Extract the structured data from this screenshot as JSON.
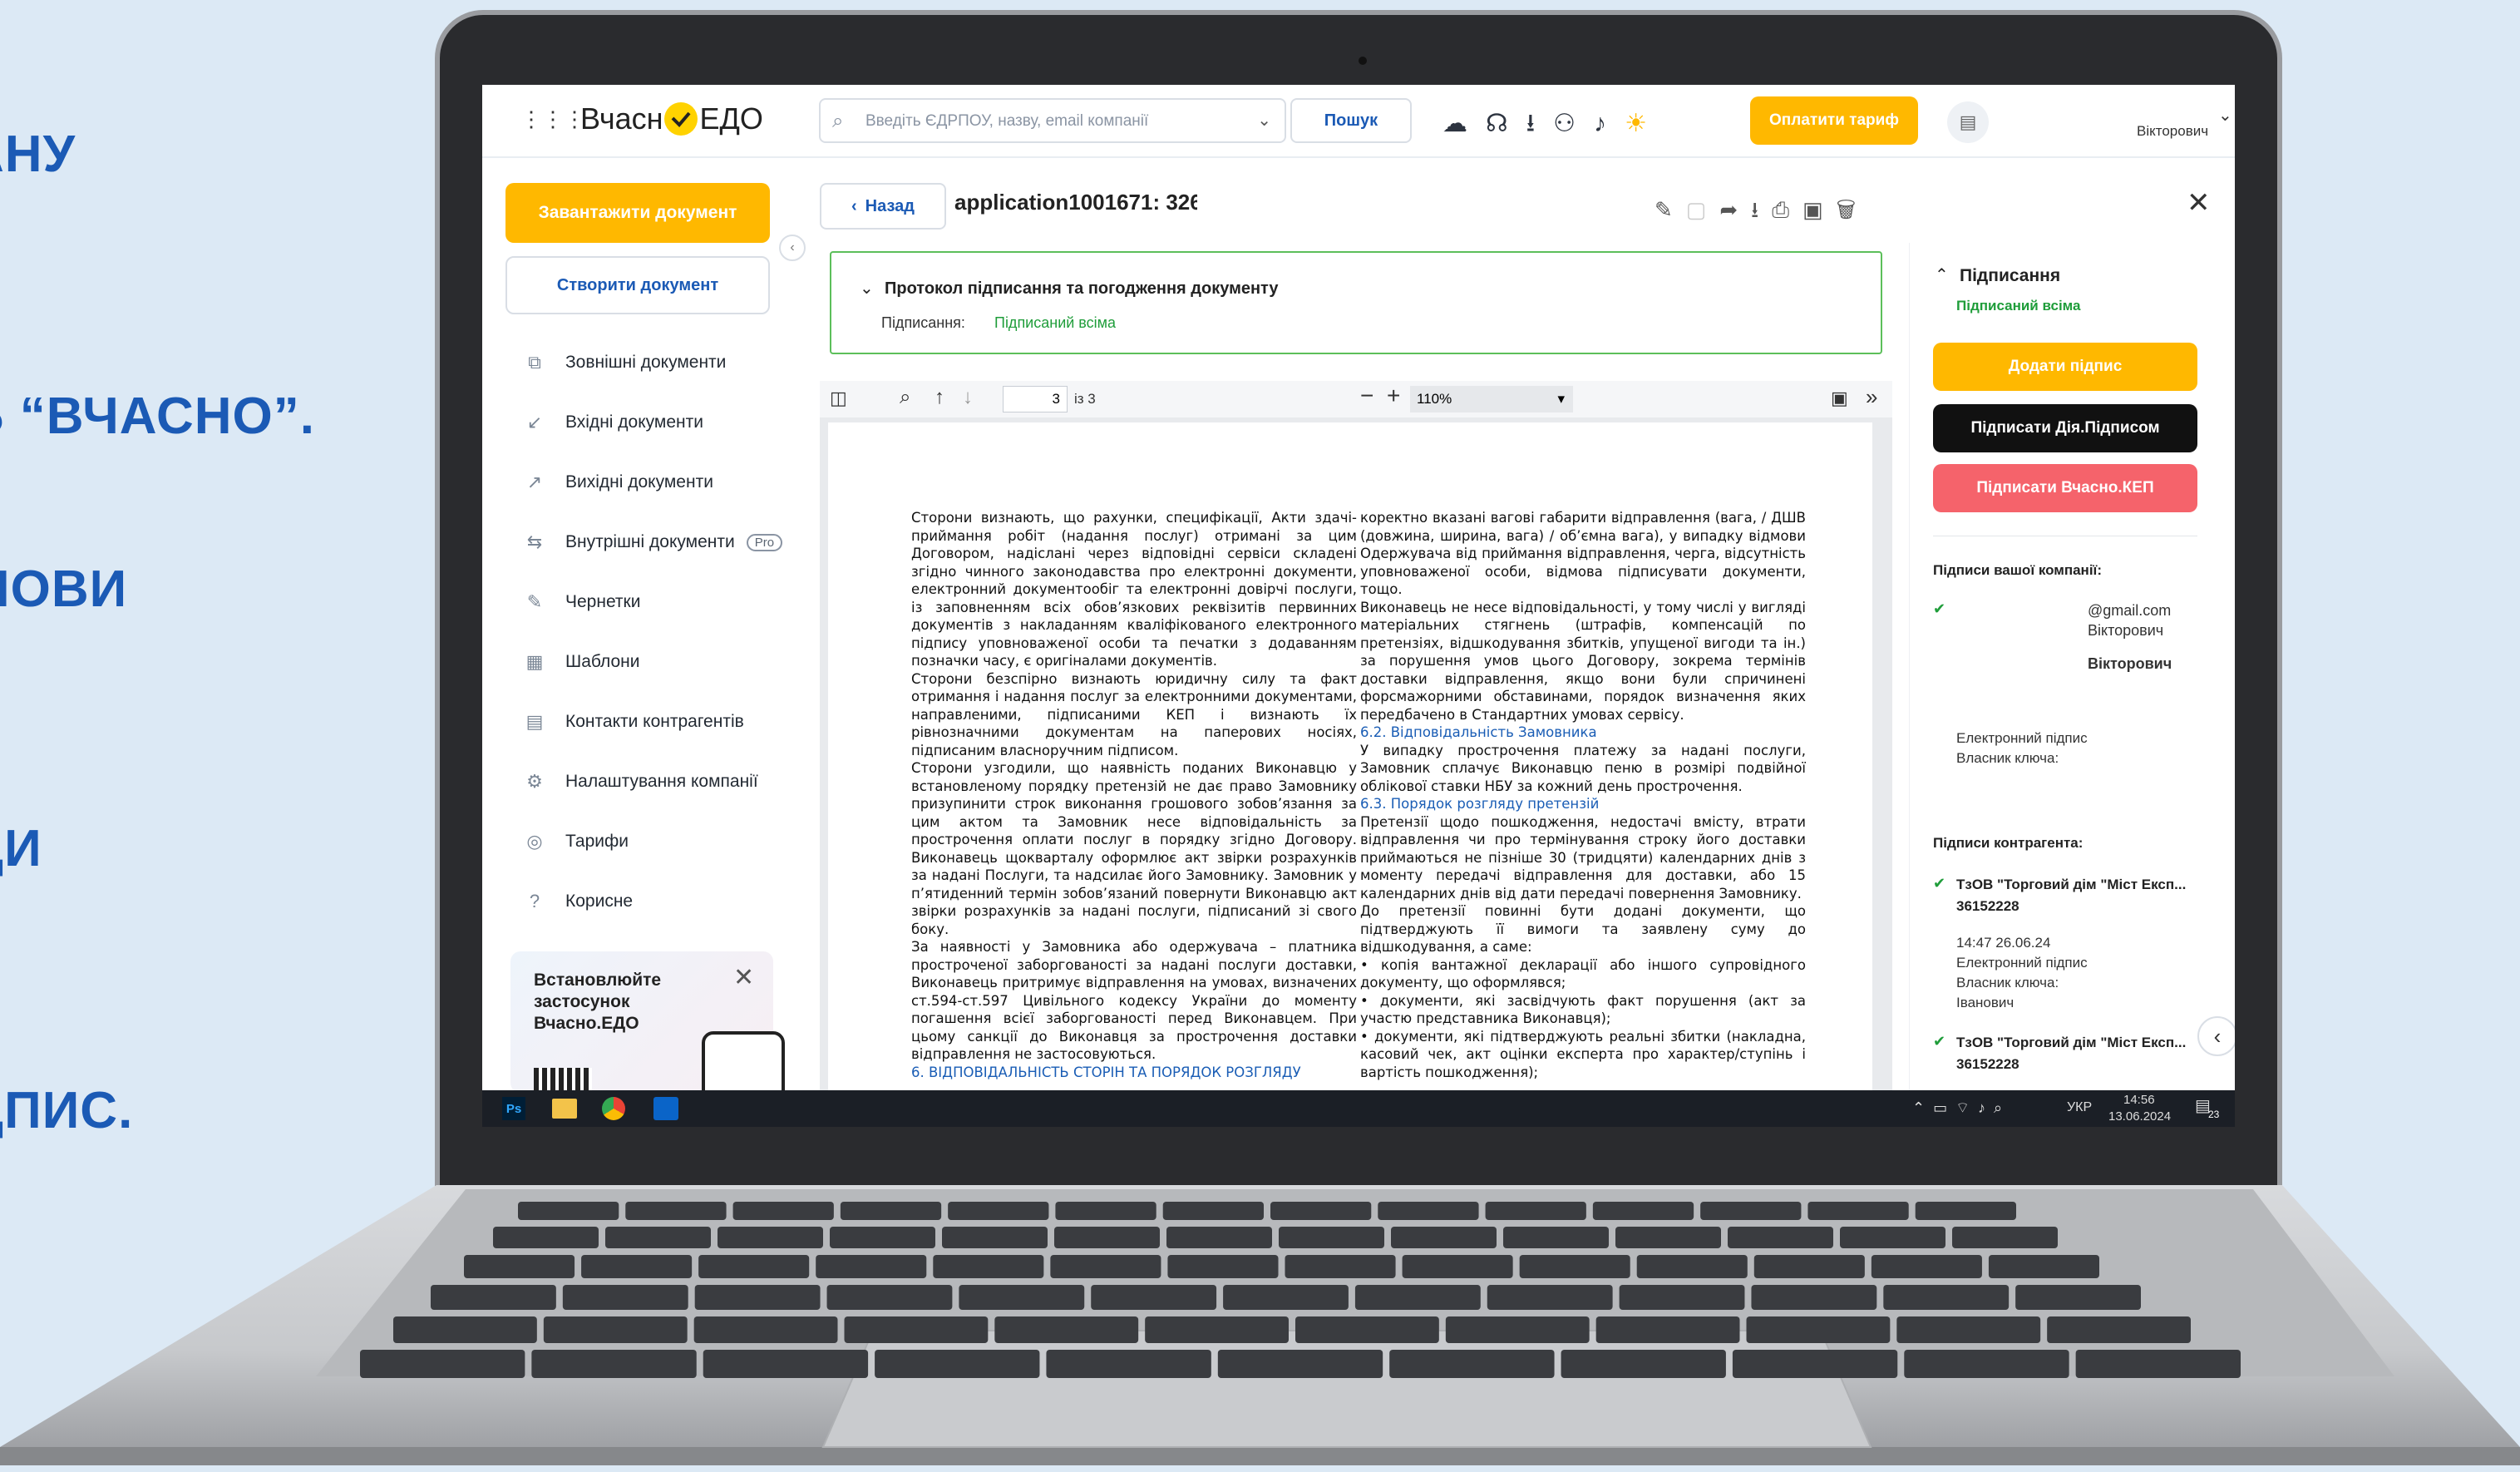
{
  "promo": {
    "line1": "АНУ",
    "line2": "Ь “ВЧАСНО”.",
    "line3": "МОВИ",
    "line4": "ДИ",
    "line5": "ДПИС."
  },
  "app": {
    "logo_text_left": "Вчасн",
    "logo_text_right": "ЕДО",
    "search_placeholder": "Введіть ЄДРПОУ, назву, email компанії",
    "search_button": "Пошук",
    "pay_button": "Оплатити тариф",
    "user_name": "Вікторович"
  },
  "sidebar": {
    "upload_button": "Завантажити документ",
    "create_button": "Створити документ",
    "items": [
      {
        "label": "Зовнішні документи",
        "icon": "external-docs-icon"
      },
      {
        "label": "Вхідні документи",
        "icon": "incoming-arrow-icon"
      },
      {
        "label": "Вихідні документи",
        "icon": "outgoing-arrow-icon"
      },
      {
        "label": "Внутрішні документи",
        "icon": "internal-docs-icon",
        "badge": "Pro"
      },
      {
        "label": "Чернетки",
        "icon": "draft-icon"
      },
      {
        "label": "Шаблони",
        "icon": "template-icon"
      },
      {
        "label": "Контакти контрагентів",
        "icon": "contacts-icon"
      },
      {
        "label": "Налаштування компанії",
        "icon": "gear-icon"
      },
      {
        "label": "Тарифи",
        "icon": "tariff-icon"
      },
      {
        "label": "Корисне",
        "icon": "help-icon"
      }
    ],
    "promo_card_text": "Встановлюйте застосунок Вчасно.ЕДО"
  },
  "document": {
    "back_button": "Назад",
    "title": "application1001671: 326",
    "protocol_title": "Протокол підписання та погодження документу",
    "protocol_label": "Підписання:",
    "protocol_status": "Підписаний всіма",
    "page_current": "3",
    "page_total": "із 3",
    "zoom": "110%",
    "left_column": [
      {
        "t": "Сторони визнають, що рахунки, специфікації, Акти здачі-приймання робіт (надання послуг) отримані за цим Договором, надіслані через відповідні сервіси складені згідно чинного законодавства про електронні документи, електронний документообіг та електронні довірчі послуги, із заповненням всіх обов’язкових реквізитів первинних документів з накладанням кваліфікованого електронного підпису уповноваженої особи та печатки з додаванням позначки часу, є оригіналами документів."
      },
      {
        "t": "Сторони безспірно визнають юридичну силу та факт отримання і надання послуг за електронними документами, направленими, підписаними КЕП і визнають їх рівнозначними документам на паперових носіях, підписаним власноручним підписом."
      },
      {
        "t": "Сторони узгодили, що наявність поданих Виконавцю у встановленому порядку претензій не дає право Замовнику призупинити строк виконання грошового зобов’язання за цим актом та Замовник несе відповідальність за прострочення оплати послуг в порядку згідно Договору. Виконавець щокварталу оформлює акт звірки розрахунків за надані Послуги, та надсилає його Замовнику. Замовник у п’ятиденний термін зобов’язаний повернути Виконавцю акт звірки розрахунків за надані послуги, підписаний зі свого боку."
      },
      {
        "t": "За наявності у Замовника або одержувача – платника простроченої заборгованості за надані послуги доставки, Виконавець притримує відправлення на умовах, визначених ст.594-ст.597 Цивільного кодексу України до моменту погашення всієї заборгованості перед Виконавцем. При цьому санкції до Виконавця за прострочення доставки відправлення не застосовуються."
      },
      {
        "t": "6. ВІДПОВІДАЛЬНІСТЬ СТОРІН ТА ПОРЯДОК РОЗГЛЯДУ",
        "h": true
      }
    ],
    "right_column": [
      {
        "t": "коректно вказані вагові габарити відправлення (вага, / ДШВ (довжина, ширина, вага) / об’ємна вага), у випадку відмови Одержувача від приймання відправлення, черга, відсутність уповноваженої особи, відмова підписувати документи, тощо."
      },
      {
        "t": "Виконавець не несе відповідальності, у тому числі у вигляді матеріальних стягнень (штрафів, компенсацій по претензіях, відшкодування збитків, упущеної вигоди та ін.) за порушення умов цього Договору, зокрема термінів доставки відправлення, якщо вони були спричинені форсмажорними обставинами, порядок визначення яких передбачено в Стандартних умовах сервісу."
      },
      {
        "t": "6.2. Відповідальність Замовника",
        "h": true
      },
      {
        "t": "У випадку прострочення платежу за надані послуги, Замовник сплачує Виконавцю пеню в розмірі подвійної облікової ставки НБУ за кожний день прострочення."
      },
      {
        "t": "6.3. Порядок розгляду претензій",
        "h": true
      },
      {
        "t": "Претензії щодо пошкодження, недостачі вмісту, втрати відправлення чи про термінування строку його доставки приймаються не пізніше 30 (тридцяти) календарних днів з моменту передачі відправлення для доставки, або 15 календарних днів від дати передачі повернення Замовнику."
      },
      {
        "t": "До претензії повинні бути додані документи, що підтверджують її вимоги та заявлену суму до відшкодування, а саме:"
      },
      {
        "t": "• копія вантажної декларації або іншого супровідного документу, що оформлявся;"
      },
      {
        "t": "• документи, які засвідчують факт порушення (акт за участю представника Виконавця);"
      },
      {
        "t": "• документи, які підтверджують реальні збитки (накладна, касовий чек, акт оцінки експерта про характер/ступінь і вартість пошкодження);"
      }
    ]
  },
  "right_panel": {
    "section_title": "Підписання",
    "status": "Підписаний всіма",
    "add_signature": "Додати підпис",
    "sign_diia": "Підписати Дія.Підписом",
    "sign_vchasno": "Підписати Вчасно.КЕП",
    "own_signatures_title": "Підписи вашої компанії:",
    "own_signer_email": "@gmail.com",
    "own_signer_name1": "Вікторович",
    "own_signer_name2": "Вікторович",
    "own_sig_type": "Електронний підпис",
    "own_key_owner": "Власник ключа:",
    "counterparty_title": "Підписи контрагента:",
    "cp1_name": "ТзОВ \"Торговий дім \"Міст Експ...",
    "cp1_code": "36152228",
    "cp1_time": "14:47 26.06.24",
    "cp1_type": "Електронний підпис",
    "cp1_key": "Власник ключа:",
    "cp1_owner": "Іванович",
    "cp2_name": "ТзОВ \"Торговий дім \"Міст Експ...",
    "cp2_code": "36152228"
  },
  "taskbar": {
    "lang": "УКР",
    "time": "14:56",
    "date": "13.06.2024",
    "notif_count": "23",
    "app_ps": "Ps"
  },
  "colors": {
    "accent_yellow": "#ffb800",
    "brand_blue": "#1b5ab5",
    "success_green": "#1f9d3a",
    "danger_red": "#f5636b"
  }
}
